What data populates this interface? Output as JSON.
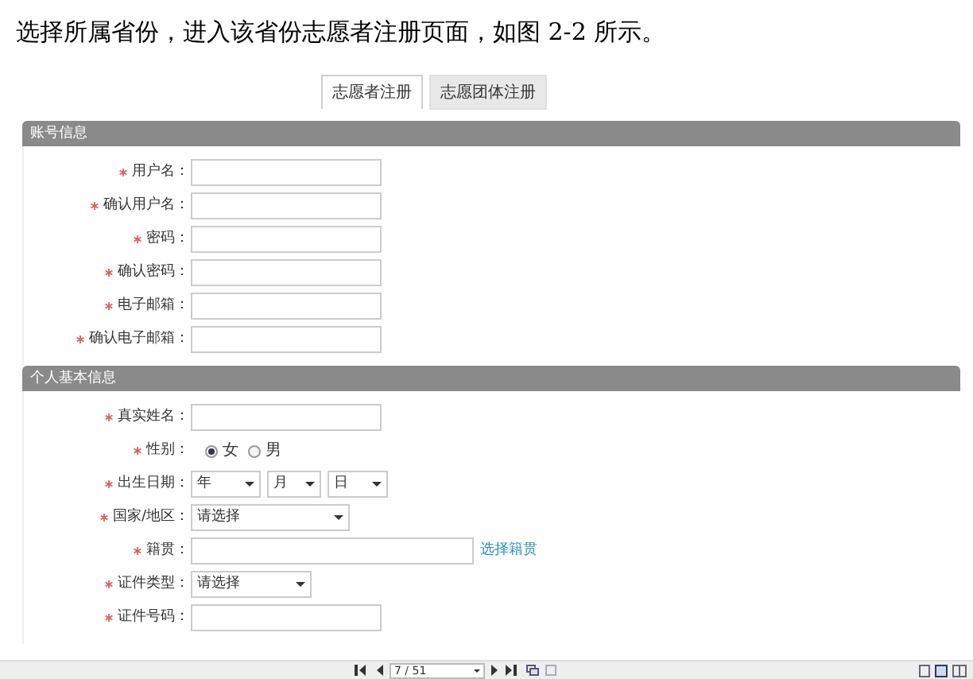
{
  "heading": "选择所属省份，进入该省份志愿者注册页面，如图 2-2 所示。",
  "tabs": [
    {
      "label": "志愿者注册",
      "selected": true
    },
    {
      "label": "志愿团体注册",
      "selected": false
    }
  ],
  "sections": [
    {
      "title": "账号信息",
      "fields": [
        {
          "kind": "text",
          "label": "用户名：",
          "required": true
        },
        {
          "kind": "text",
          "label": "确认用户名：",
          "required": true
        },
        {
          "kind": "text",
          "label": "密码：",
          "required": true
        },
        {
          "kind": "text",
          "label": "确认密码：",
          "required": true
        },
        {
          "kind": "text",
          "label": "电子邮箱：",
          "required": true
        },
        {
          "kind": "text",
          "label": "确认电子邮箱：",
          "required": true
        }
      ]
    },
    {
      "title": "个人基本信息",
      "fields": [
        {
          "kind": "text",
          "label": "真实姓名：",
          "required": true
        },
        {
          "kind": "radio",
          "label": "性别：",
          "required": true,
          "options": [
            {
              "label": "女",
              "selected": true
            },
            {
              "label": "男",
              "selected": false
            }
          ]
        },
        {
          "kind": "dates",
          "label": "出生日期：",
          "required": true,
          "selects": [
            "年",
            "月",
            "日"
          ]
        },
        {
          "kind": "select",
          "label": "国家/地区：",
          "required": true,
          "value": "请选择"
        },
        {
          "kind": "text",
          "label": "籍贯：",
          "required": true,
          "link": "选择籍贯"
        },
        {
          "kind": "select",
          "label": "证件类型：",
          "required": true,
          "value": "请选择"
        },
        {
          "kind": "text",
          "label": "证件号码：",
          "required": true
        }
      ]
    }
  ],
  "toolbar": {
    "page": "7 / 51"
  }
}
